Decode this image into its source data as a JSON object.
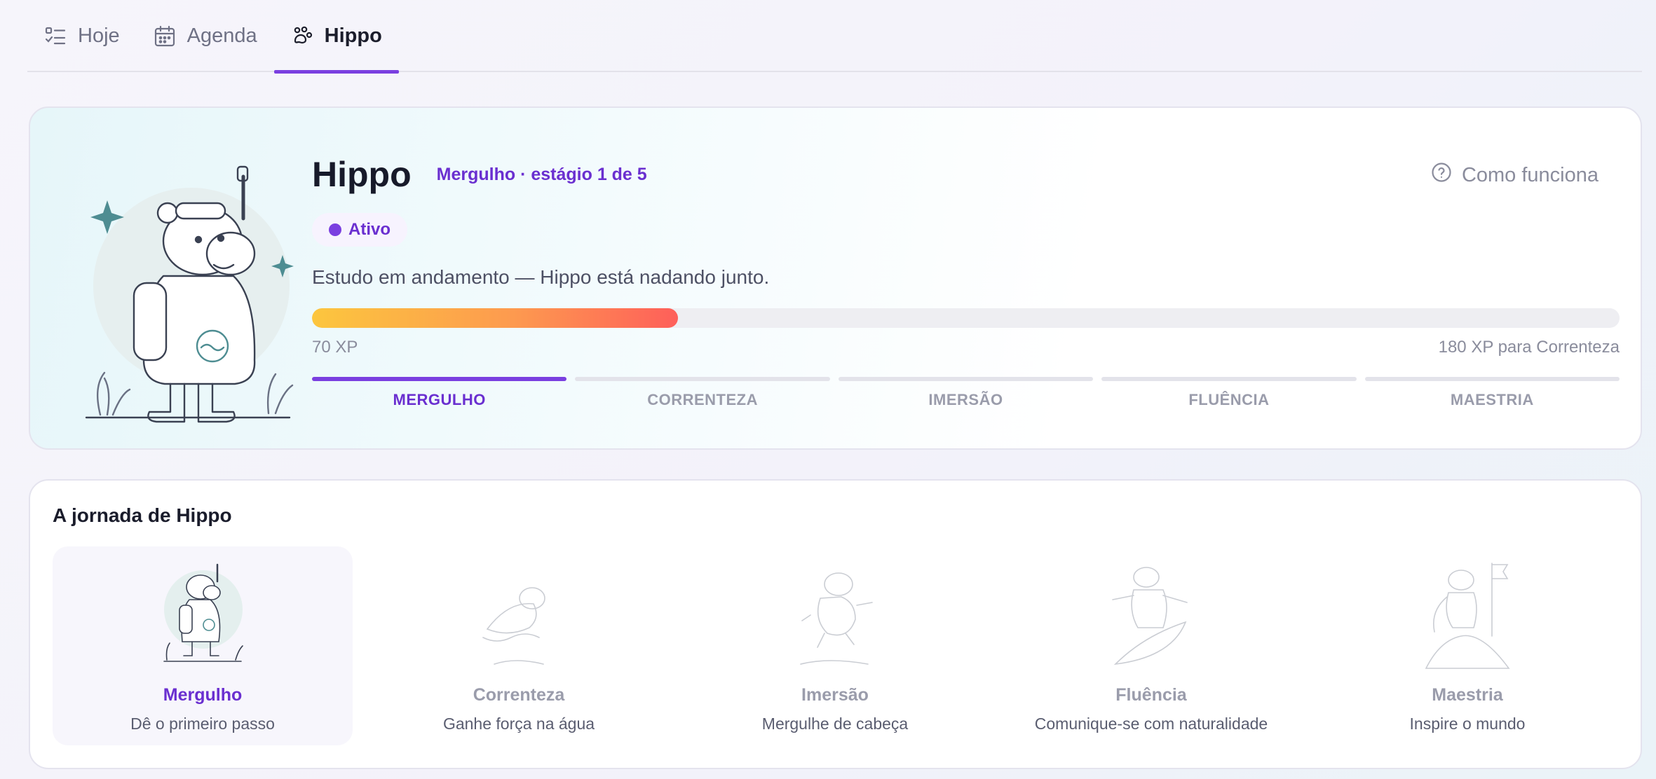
{
  "colors": {
    "accent": "#7a3fe0",
    "accent_text": "#6a2fd0",
    "muted": "#9a9cab",
    "xp_start": "#fcc63e",
    "xp_end": "#fe5f5a"
  },
  "tabs": [
    {
      "label": "Hoje",
      "icon": "checklist-icon"
    },
    {
      "label": "Agenda",
      "icon": "calendar-icon"
    },
    {
      "label": "Hippo",
      "icon": "paw-icon",
      "active": true
    }
  ],
  "hero": {
    "title": "Hippo",
    "stage_badge": "Mergulho · estágio 1 de 5",
    "help_link": "Como funciona",
    "help_icon": "question-circle-icon",
    "status_pill": "Ativo",
    "status_text": "Estudo em andamento — Hippo está nadando junto.",
    "xp_progress": 0.28,
    "xp_current": "70 XP",
    "xp_next": "180 XP para Correnteza",
    "stages": [
      "MERGULHO",
      "CORRENTEZA",
      "IMERSÃO",
      "FLUÊNCIA",
      "MAESTRIA"
    ],
    "active_stage": 0
  },
  "journey": {
    "title": "A jornada de Hippo",
    "items": [
      {
        "name": "Mergulho",
        "subtitle": "Dê o primeiro passo",
        "current": true
      },
      {
        "name": "Correnteza",
        "subtitle": "Ganhe força na água",
        "current": false
      },
      {
        "name": "Imersão",
        "subtitle": "Mergulhe de cabeça",
        "current": false
      },
      {
        "name": "Fluência",
        "subtitle": "Comunique-se com naturalidade",
        "current": false
      },
      {
        "name": "Maestria",
        "subtitle": "Inspire o mundo",
        "current": false
      }
    ]
  }
}
